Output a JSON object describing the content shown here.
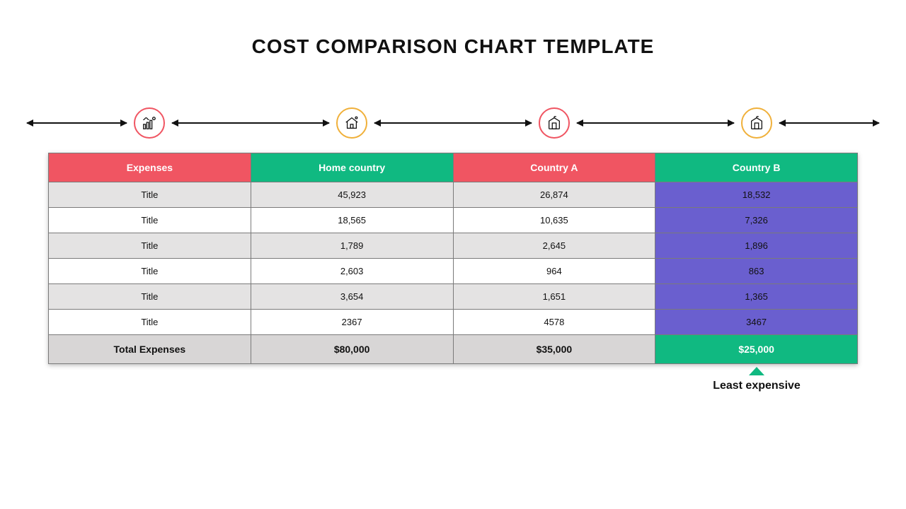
{
  "title": "COST COMPARISON CHART TEMPLATE",
  "columns": {
    "expenses": "Expenses",
    "home": "Home country",
    "a": "Country A",
    "b": "Country B"
  },
  "rows": [
    {
      "label": "Title",
      "home": "45,923",
      "a": "26,874",
      "b": "18,532"
    },
    {
      "label": "Title",
      "home": "18,565",
      "a": "10,635",
      "b": "7,326"
    },
    {
      "label": "Title",
      "home": "1,789",
      "a": "2,645",
      "b": "1,896"
    },
    {
      "label": "Title",
      "home": "2,603",
      "a": "964",
      "b": "863"
    },
    {
      "label": "Title",
      "home": "3,654",
      "a": "1,651",
      "b": "1,365"
    },
    {
      "label": "Title",
      "home": "2367",
      "a": "4578",
      "b": "3467"
    }
  ],
  "total": {
    "label": "Total Expenses",
    "home": "$80,000",
    "a": "$35,000",
    "b": "$25,000"
  },
  "callout": "Least expensive",
  "icons": {
    "col0": "finance-growth-icon",
    "col1": "house-icon",
    "col2": "building-icon",
    "col3": "building-icon"
  },
  "colors": {
    "red": "#f05562",
    "green": "#10b981",
    "gold": "#f0b03a",
    "purple": "#6a5fcf"
  },
  "chart_data": {
    "type": "table",
    "title": "COST COMPARISON CHART TEMPLATE",
    "columns": [
      "Expenses",
      "Home country",
      "Country A",
      "Country B"
    ],
    "rows": [
      [
        "Title",
        45923,
        26874,
        18532
      ],
      [
        "Title",
        18565,
        10635,
        7326
      ],
      [
        "Title",
        1789,
        2645,
        1896
      ],
      [
        "Title",
        2603,
        964,
        863
      ],
      [
        "Title",
        3654,
        1651,
        1365
      ],
      [
        "Title",
        2367,
        4578,
        3467
      ]
    ],
    "totals": {
      "Home country": 80000,
      "Country A": 35000,
      "Country B": 25000
    },
    "annotation": {
      "column": "Country B",
      "text": "Least expensive"
    }
  }
}
